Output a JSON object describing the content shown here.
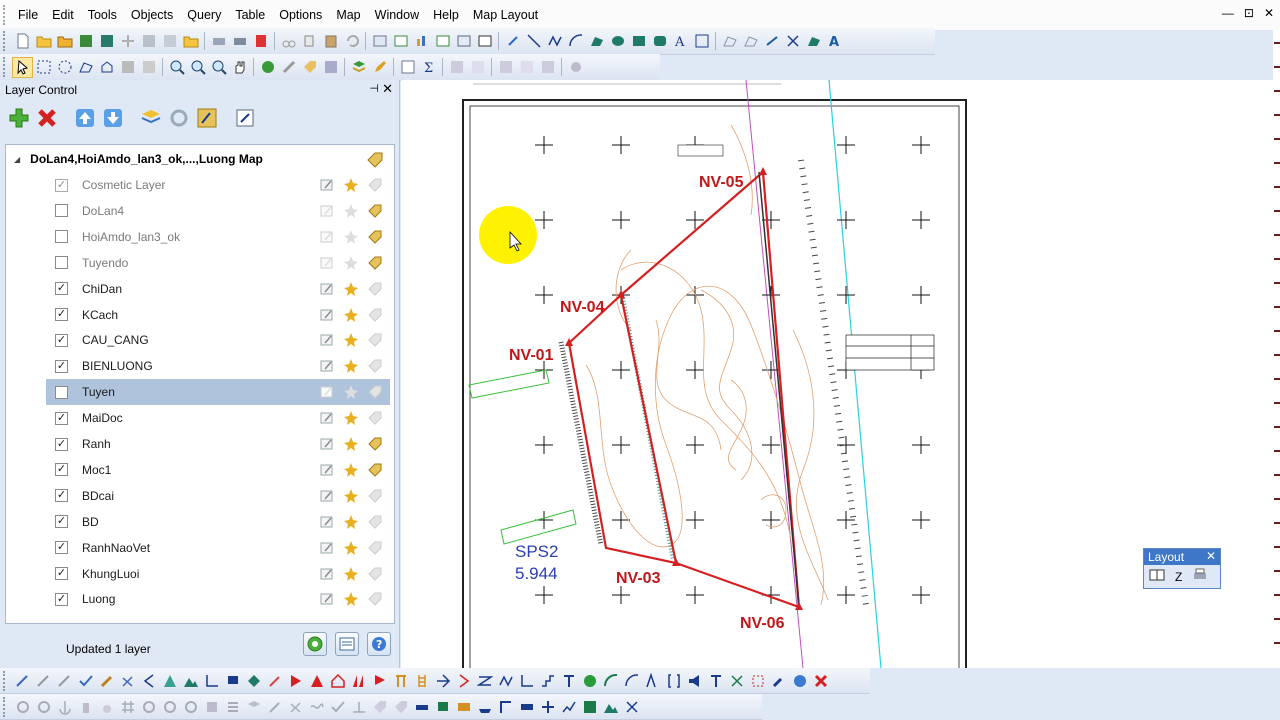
{
  "menu": [
    "File",
    "Edit",
    "Tools",
    "Objects",
    "Query",
    "Table",
    "Options",
    "Map",
    "Window",
    "Help",
    "Map Layout"
  ],
  "window_controls": [
    "—",
    "⊡",
    "✕"
  ],
  "layer_control": {
    "title": "Layer Control",
    "pin": "⊣",
    "close": "✕",
    "map_name": "DoLan4,HoiAmdo_lan3_ok,...,Luong Map",
    "layers": [
      {
        "name": "Cosmetic Layer",
        "checked": true,
        "greyed": true,
        "dim": false
      },
      {
        "name": "DoLan4",
        "checked": false,
        "greyed": false,
        "dim": true
      },
      {
        "name": "HoiAmdo_lan3_ok",
        "checked": false,
        "greyed": false,
        "dim": true
      },
      {
        "name": "Tuyendo",
        "checked": false,
        "greyed": false,
        "dim": true
      },
      {
        "name": "ChiDan",
        "checked": true,
        "greyed": false,
        "dim": false
      },
      {
        "name": "KCach",
        "checked": true,
        "greyed": false,
        "dim": false
      },
      {
        "name": "CAU_CANG",
        "checked": true,
        "greyed": false,
        "dim": false
      },
      {
        "name": "BIENLUONG",
        "checked": true,
        "greyed": false,
        "dim": false
      },
      {
        "name": "Tuyen",
        "checked": false,
        "greyed": false,
        "dim": false
      },
      {
        "name": "MaiDoc",
        "checked": true,
        "greyed": false,
        "dim": false
      },
      {
        "name": "Ranh",
        "checked": true,
        "greyed": false,
        "dim": false
      },
      {
        "name": "Moc1",
        "checked": true,
        "greyed": false,
        "dim": false
      },
      {
        "name": "BDcai",
        "checked": true,
        "greyed": false,
        "dim": false
      },
      {
        "name": "BD",
        "checked": true,
        "greyed": false,
        "dim": false
      },
      {
        "name": "RanhNaoVet",
        "checked": true,
        "greyed": false,
        "dim": false
      },
      {
        "name": "KhungLuoi",
        "checked": true,
        "greyed": false,
        "dim": false
      },
      {
        "name": "Luong",
        "checked": true,
        "greyed": false,
        "dim": false
      }
    ],
    "selected_layer": "Tuyen",
    "status": "Updated 1 layer"
  },
  "map": {
    "points": [
      {
        "label": "NV-05"
      },
      {
        "label": "NV-04"
      },
      {
        "label": "NV-01"
      },
      {
        "label": "NV-03"
      },
      {
        "label": "NV-06"
      }
    ],
    "station": {
      "name": "SPS2",
      "value": "5.944"
    }
  },
  "layout_toolbar": {
    "title": "Layout",
    "close": "✕",
    "zoom_label": "Z"
  },
  "colors": {
    "accent": "#3e77c8",
    "boundary": "#d42020",
    "contour": "#e0a070",
    "label_red": "#c01818",
    "label_blue": "#2b3fb0",
    "highlight": "#fff200"
  }
}
